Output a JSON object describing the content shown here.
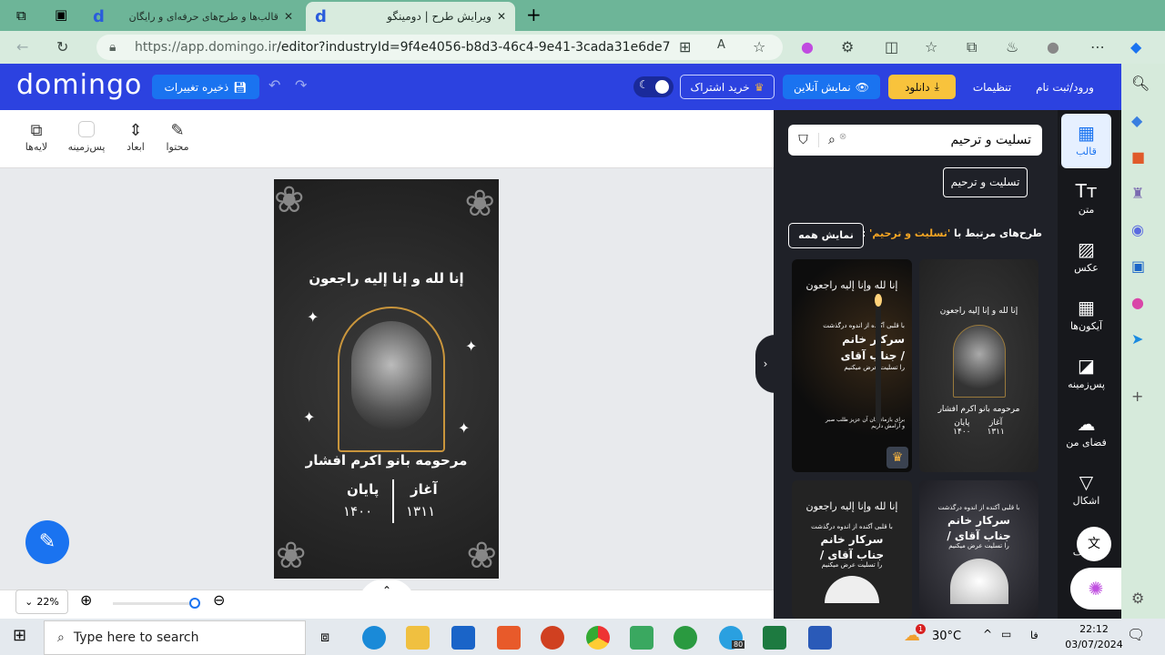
{
  "browser": {
    "tabs": [
      {
        "title": "قالب‌ها و طرح‌های حرفه‌ای و رایگان",
        "active": false
      },
      {
        "title": "ویرایش طرح | دومینگو",
        "active": true
      }
    ],
    "url_host": "https://app.domingo.ir",
    "url_path": "/editor?industryId=9f4e4056-b8d3-46c4-9e41-3cada31e6de7",
    "favicon": "d"
  },
  "header": {
    "logo": "domingo",
    "save_label": "ذخیره تغییرات",
    "subscribe_label": "خرید اشتراک",
    "preview_label": "نمایش آنلاین",
    "download_label": "دانلود",
    "settings_label": "تنظیمات",
    "login_label": "ورود/ثبت نام",
    "colors": {
      "header": "#2c42e0",
      "download": "#f8c33c",
      "preview": "#1a73f0"
    }
  },
  "toolbar": {
    "content": "محتوا",
    "dimensions": "ابعاد",
    "background": "پس‌زمینه",
    "layers": "لایه‌ها"
  },
  "design": {
    "verse": "إنا لله و إنا إليه راجعون",
    "name": "مرحومه بانو اکرم افشار",
    "start_label": "آغاز",
    "end_label": "پایان",
    "start_year": "۱۳۱۱",
    "end_year": "۱۴۰۰"
  },
  "zoom": {
    "value": "22%"
  },
  "panel": {
    "search_value": "تسلیت و ترحیم",
    "tag": "تسلیت و ترحیم",
    "related_prefix": "طرح‌های مرتبط با",
    "related_term": "'تسلیت و ترحیم'",
    "related_suffix": ":",
    "show_all": "نمایش همه",
    "thumbs": [
      {
        "verse": "إنا لله و إنا إليه راجعون",
        "name": "مرحومه بانو اکرم افشار",
        "start_label": "آغاز",
        "end_label": "پایان",
        "start_year": "۱۳۱۱",
        "end_year": "۱۴۰۰"
      },
      {
        "verse": "إنا لله وإنا إليه راجعون",
        "line1": "با قلبی آکنده از اندوه درگذشت",
        "line2": "سرکار خانم",
        "line3": "/ جناب آقای",
        "line4": "را تسلیت عرض میکنیم",
        "line5": "برای بازماندگان آن عزیز طلب صبر",
        "line6": "و آرامش داریم",
        "premium": true
      },
      {
        "line1": "با قلبی آکنده از اندوه درگذشت",
        "line2": "سرکار خانم",
        "line3": "/ جناب آقای",
        "line4": "را تسلیت عرض میکنیم"
      },
      {
        "verse": "إنا لله وإنا إليه راجعون",
        "line1": "با قلبی آکنده از اندوه درگذشت",
        "line2": "سرکار خانم",
        "line3": "/ جناب آقای",
        "line4": "را تسلیت عرض میکنیم"
      }
    ]
  },
  "rail": [
    {
      "label": "قالب",
      "icon": "layout-icon"
    },
    {
      "label": "متن",
      "icon": "text-icon"
    },
    {
      "label": "عکس",
      "icon": "image-icon"
    },
    {
      "label": "آیکون‌ها",
      "icon": "grid-icon"
    },
    {
      "label": "پس‌زمینه",
      "icon": "background-icon"
    },
    {
      "label": "فضای من",
      "icon": "upload-cloud-icon"
    },
    {
      "label": "اشکال",
      "icon": "shapes-icon"
    },
    {
      "label": "حروف",
      "icon": "fonts-icon"
    }
  ],
  "taskbar": {
    "search_placeholder": "Type here to search",
    "temperature": "30°C",
    "lang": "فا",
    "time": "22:12",
    "date": "03/07/2024",
    "weather_badge": "1",
    "telegram_badge": "80"
  }
}
